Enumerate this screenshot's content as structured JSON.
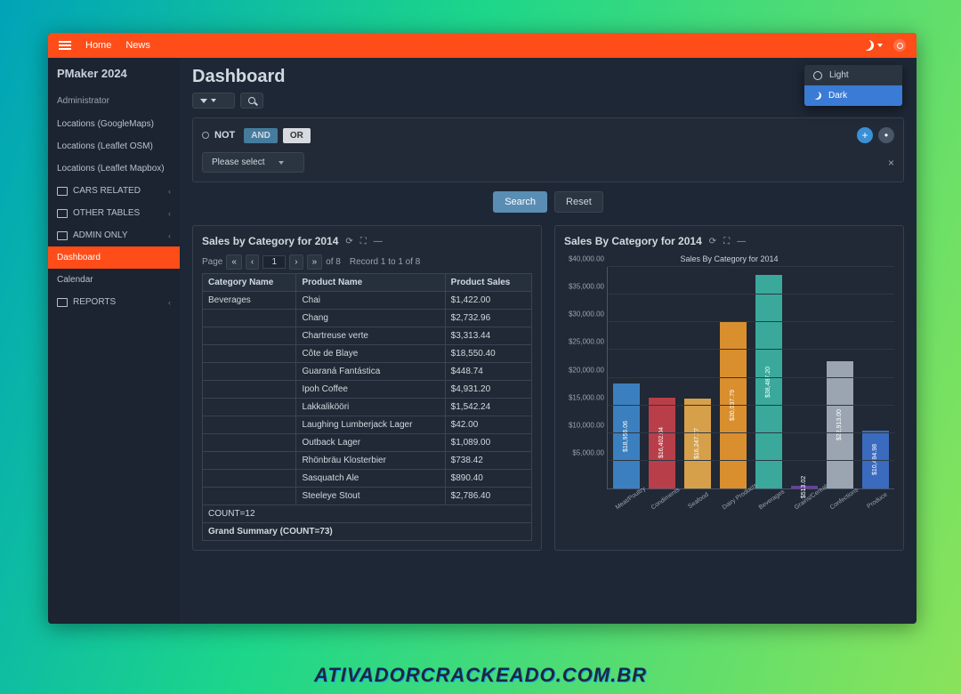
{
  "app_title": "PMaker 2024",
  "topnav": {
    "home": "Home",
    "news": "News"
  },
  "theme_popup": {
    "light": "Light",
    "dark": "Dark"
  },
  "breadcrumb": "Dashboard",
  "sidebar": {
    "user": "Administrator",
    "items": [
      {
        "label": "Locations (GoogleMaps)"
      },
      {
        "label": "Locations (Leaflet OSM)"
      },
      {
        "label": "Locations (Leaflet Mapbox)"
      }
    ],
    "groups": [
      {
        "label": "CARS RELATED"
      },
      {
        "label": "OTHER TABLES"
      },
      {
        "label": "ADMIN ONLY"
      }
    ],
    "dash": "Dashboard",
    "cal": "Calendar",
    "reports": "REPORTS"
  },
  "page_title": "Dashboard",
  "filter": {
    "not": "NOT",
    "and": "AND",
    "or": "OR",
    "select": "Please select"
  },
  "buttons": {
    "search": "Search",
    "reset": "Reset"
  },
  "table_card": {
    "title": "Sales by Category for 2014",
    "pager": {
      "page": "Page",
      "pg": "1",
      "of": "of 8",
      "rec": "Record 1 to 1 of 8"
    },
    "cols": [
      "Category Name",
      "Product Name",
      "Product Sales"
    ],
    "cat": "Beverages",
    "rows": [
      [
        "Chai",
        "$1,422.00"
      ],
      [
        "Chang",
        "$2,732.96"
      ],
      [
        "Chartreuse verte",
        "$3,313.44"
      ],
      [
        "Côte de Blaye",
        "$18,550.40"
      ],
      [
        "Guaraná Fantástica",
        "$448.74"
      ],
      [
        "Ipoh Coffee",
        "$4,931.20"
      ],
      [
        "Lakkalikööri",
        "$1,542.24"
      ],
      [
        "Laughing Lumberjack Lager",
        "$42.00"
      ],
      [
        "Outback Lager",
        "$1,089.00"
      ],
      [
        "Rhönbräu Klosterbier",
        "$738.42"
      ],
      [
        "Sasquatch Ale",
        "$890.40"
      ],
      [
        "Steeleye Stout",
        "$2,786.40"
      ]
    ],
    "count": "COUNT=12",
    "grand": "Grand Summary (COUNT=73)"
  },
  "chart_card": {
    "title": "Sales By Category for 2014",
    "subtitle": "Sales By Category for 2014"
  },
  "chart_data": {
    "type": "bar",
    "title": "Sales By Category for 2014",
    "xlabel": "",
    "ylabel": "",
    "ylim": [
      0,
      40000
    ],
    "yticks": [
      "$40,000.00",
      "$35,000.00",
      "$30,000.00",
      "$25,000.00",
      "$20,000.00",
      "$15,000.00",
      "$10,000.00",
      "$5,000.00"
    ],
    "categories": [
      "Meat/Poultry",
      "Condiments",
      "Seafood",
      "Dairy Products",
      "Beverages",
      "Grains/Cereals",
      "Confections",
      "Produce"
    ],
    "values": [
      18956.06,
      16402.04,
      16247.77,
      30037.79,
      38487.2,
      513.02,
      22913.0,
      10494.98
    ],
    "value_labels": [
      "$18,956.06",
      "$16,402.04",
      "$16,247.77",
      "$30,037.79",
      "$38,487.20",
      "$513.02",
      "$22,913.00",
      "$10,494.98"
    ],
    "colors": [
      "#3b7fbf",
      "#b83f49",
      "#d6a04a",
      "#d98f2e",
      "#3aa99b",
      "#6b3fa0",
      "#9aa5b1",
      "#3b6bbf"
    ]
  },
  "footer": "ATIVADORCRACKEADO.COM.BR"
}
